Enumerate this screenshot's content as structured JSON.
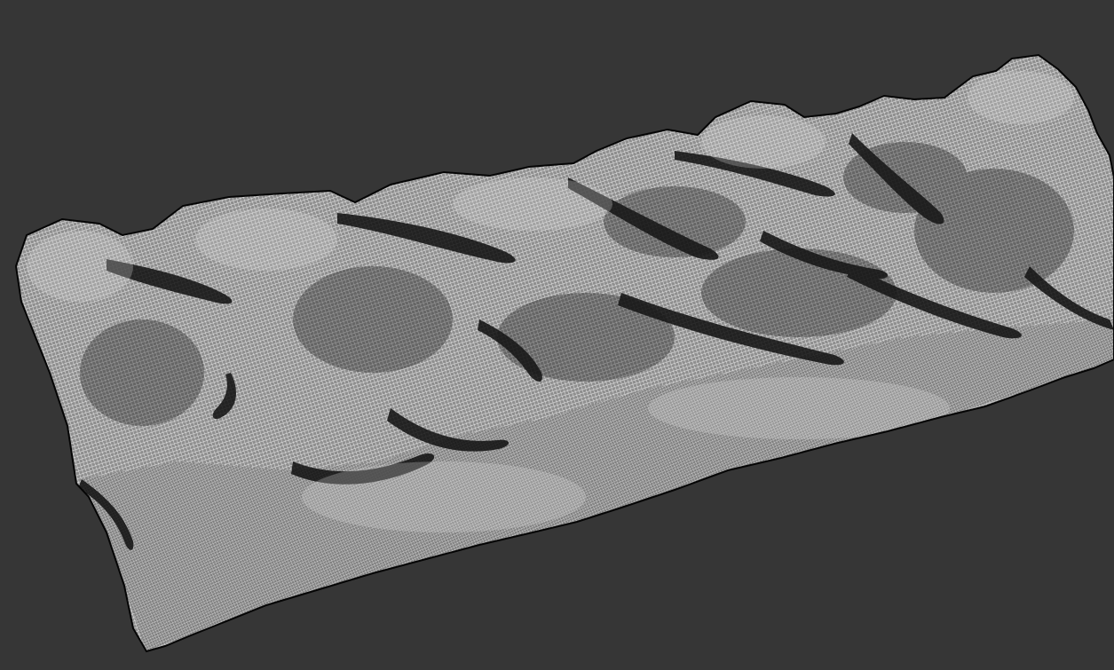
{
  "viewport": {
    "background_color": "#363636",
    "display_mode": "wireframe"
  },
  "terrain_mesh": {
    "type": "rocky ridge terrain",
    "wire_color": "#ececec",
    "shadow_color": "#000000",
    "shade_color": "#1a1a1a"
  }
}
